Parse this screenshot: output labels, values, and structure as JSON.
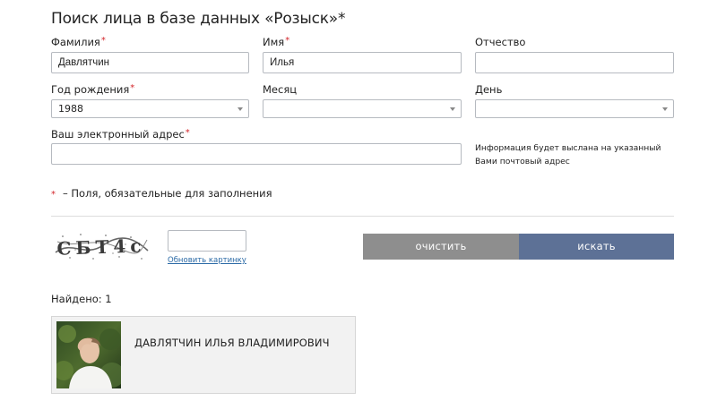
{
  "page": {
    "title": "Поиск лица в базе данных «Розыск»*"
  },
  "form": {
    "required_mark": "*",
    "surname": {
      "label": "Фамилия",
      "value": "Давлятчин",
      "required": true
    },
    "name": {
      "label": "Имя",
      "value": "Илья",
      "required": true
    },
    "patronymic": {
      "label": "Отчество",
      "value": "",
      "required": false
    },
    "birth_year": {
      "label": "Год рождения",
      "value": "1988",
      "required": true
    },
    "month": {
      "label": "Месяц",
      "value": "",
      "required": false
    },
    "day": {
      "label": "День",
      "value": "",
      "required": false
    },
    "email": {
      "label": "Ваш электронный адрес",
      "value": "",
      "required": true,
      "hint": "Информация будет выслана на указанный Вами почтовый адрес"
    },
    "required_note": "– Поля, обязательные для заполнения"
  },
  "captcha": {
    "text": "CБT4c",
    "input_value": "",
    "refresh_label": "Обновить картинку"
  },
  "buttons": {
    "clear_label": "очистить",
    "search_label": "искать"
  },
  "colors": {
    "clear_button": "#8e8e8e",
    "search_button": "#5d7196",
    "required": "#d3272c",
    "link": "#2b6aa6"
  },
  "results": {
    "found_label": "Найдено: 1",
    "items": [
      {
        "name": "ДАВЛЯТЧИН ИЛЬЯ ВЛАДИМИРОВИЧ"
      }
    ]
  }
}
